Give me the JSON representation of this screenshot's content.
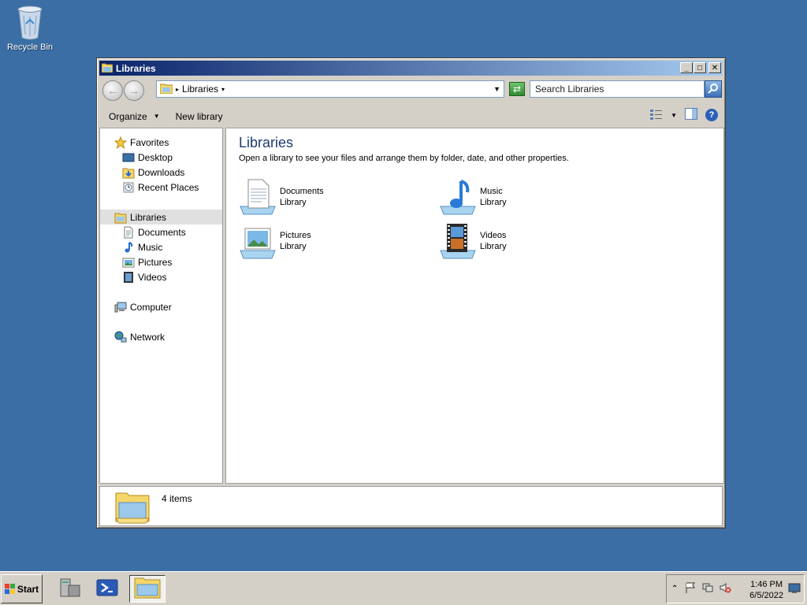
{
  "desktop": {
    "recycle_bin_label": "Recycle Bin"
  },
  "window": {
    "title": "Libraries",
    "address": {
      "crumb": "Libraries"
    },
    "search": {
      "placeholder": "Search Libraries"
    },
    "toolbar": {
      "organize": "Organize",
      "new_library": "New library"
    },
    "nav": {
      "favorites": "Favorites",
      "desktop": "Desktop",
      "downloads": "Downloads",
      "recent_places": "Recent Places",
      "libraries": "Libraries",
      "documents": "Documents",
      "music": "Music",
      "pictures": "Pictures",
      "videos": "Videos",
      "computer": "Computer",
      "network": "Network"
    },
    "content": {
      "heading": "Libraries",
      "description": "Open a library to see your files and arrange them by folder, date, and other properties.",
      "libraries": [
        {
          "name": "Documents",
          "sub": "Library"
        },
        {
          "name": "Music",
          "sub": "Library"
        },
        {
          "name": "Pictures",
          "sub": "Library"
        },
        {
          "name": "Videos",
          "sub": "Library"
        }
      ]
    },
    "details": {
      "count": "4 items"
    }
  },
  "taskbar": {
    "start_label": "Start",
    "clock_time": "1:46 PM",
    "clock_date": "6/5/2022"
  },
  "colors": {
    "desktop": "#3a6ea5",
    "titlebar": "#0a246a",
    "chrome": "#d4d0c8"
  },
  "icons": [
    "recycle-bin-icon",
    "folder-icon",
    "back-arrow-icon",
    "forward-arrow-icon",
    "refresh-icon",
    "search-icon",
    "star-icon",
    "help-icon",
    "windows-flag-icon",
    "server-manager-icon",
    "powershell-icon",
    "explorer-icon"
  ]
}
